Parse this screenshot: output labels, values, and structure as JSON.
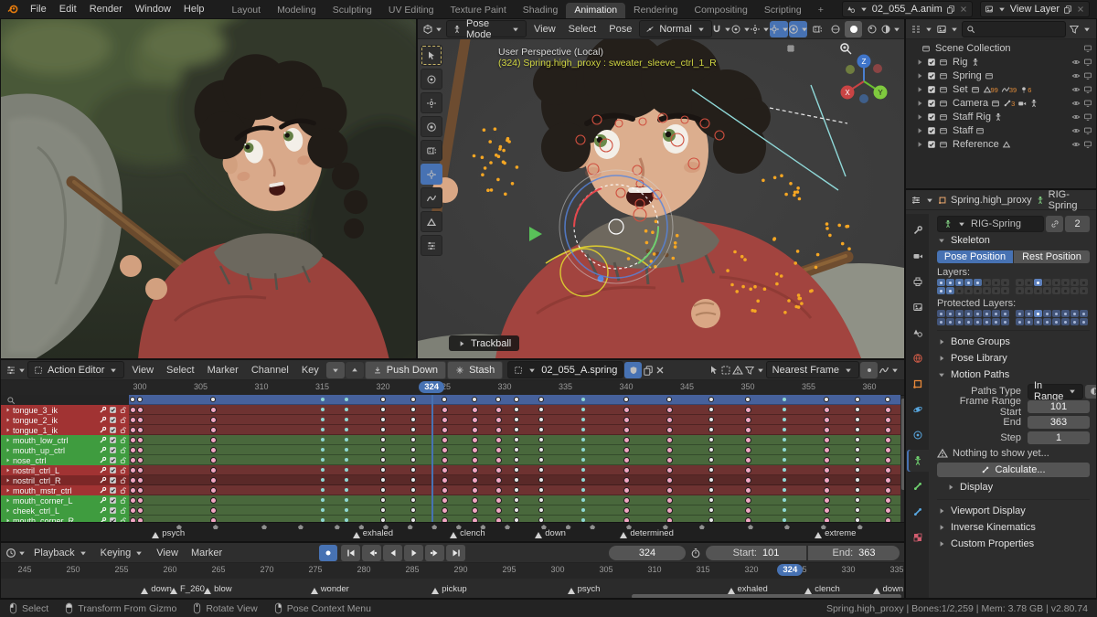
{
  "topbar": {
    "menus": [
      "File",
      "Edit",
      "Render",
      "Window",
      "Help"
    ],
    "workspaces": [
      "Layout",
      "Modeling",
      "Sculpting",
      "UV Editing",
      "Texture Paint",
      "Shading",
      "Animation",
      "Rendering",
      "Compositing",
      "Scripting"
    ],
    "active_workspace": "Animation",
    "new_workspace": "+",
    "scene_name": "02_055_A.anim",
    "view_layer_name": "View Layer"
  },
  "viewport": {
    "mode": "Pose Mode",
    "menus": [
      "View",
      "Select",
      "Pose"
    ],
    "orientation": "Normal",
    "overlay_line1": "User Perspective (Local)",
    "overlay_line2": "(324) Spring.high_proxy : sweater_sleeve_ctrl_1_R",
    "hint": "Trackball",
    "axes": {
      "x": "X",
      "y": "Y",
      "z": "Z"
    }
  },
  "outliner": {
    "root": "Scene Collection",
    "items": [
      {
        "label": "Rig",
        "badges": [
          {
            "icon": "armature"
          }
        ]
      },
      {
        "label": "Spring",
        "badges": [
          {
            "icon": "collection"
          }
        ]
      },
      {
        "label": "Set",
        "badges": [
          {
            "icon": "collection-link"
          },
          {
            "icon": "mesh",
            "count": "99"
          },
          {
            "icon": "curve",
            "count": "39"
          },
          {
            "icon": "light",
            "count": "6"
          }
        ]
      },
      {
        "label": "Camera",
        "badges": [
          {
            "icon": "collection-link"
          },
          {
            "icon": "bone",
            "count": "3"
          },
          {
            "icon": "camera"
          },
          {
            "icon": "armature"
          }
        ]
      },
      {
        "label": "Staff Rig",
        "badges": [
          {
            "icon": "armature"
          }
        ]
      },
      {
        "label": "Staff",
        "badges": [
          {
            "icon": "collection"
          }
        ]
      },
      {
        "label": "Reference",
        "badges": [
          {
            "icon": "mesh"
          }
        ]
      }
    ]
  },
  "properties": {
    "breadcrumb_object": "Spring.high_proxy",
    "breadcrumb_data": "RIG-Spring",
    "id_name": "RIG-Spring",
    "id_users": "2",
    "skeleton": {
      "title": "Skeleton",
      "pose_position": "Pose Position",
      "rest_position": "Rest Position",
      "layers_label": "Layers:",
      "layers": {
        "left": [
          [
            1,
            1,
            1,
            1,
            1,
            0,
            0,
            0
          ],
          [
            1,
            1,
            0,
            0,
            0,
            0,
            0,
            0
          ]
        ],
        "right": [
          [
            0,
            0,
            2,
            0,
            0,
            0,
            0,
            0
          ],
          [
            0,
            0,
            0,
            0,
            0,
            0,
            0,
            0
          ]
        ]
      },
      "protected_label": "Protected Layers:",
      "protected_layers": {
        "left": [
          [
            1,
            1,
            1,
            1,
            1,
            1,
            1,
            1
          ],
          [
            1,
            1,
            1,
            1,
            1,
            1,
            1,
            1
          ]
        ],
        "right": [
          [
            1,
            1,
            2,
            1,
            1,
            1,
            1,
            1
          ],
          [
            1,
            1,
            1,
            1,
            1,
            1,
            1,
            1
          ]
        ]
      }
    },
    "panels_above": [
      "Bone Groups",
      "Pose Library"
    ],
    "motion_paths": {
      "title": "Motion Paths",
      "paths_type_label": "Paths Type",
      "paths_type": "In Range",
      "fields": [
        {
          "label": "Frame Range Start",
          "value": "101"
        },
        {
          "label": "End",
          "value": "363"
        },
        {
          "label": "Step",
          "value": "1"
        }
      ],
      "warning": "Nothing to show yet...",
      "calculate": "Calculate...",
      "sub_panel": "Display"
    },
    "panels_below": [
      "Viewport Display",
      "Inverse Kinematics",
      "Custom Properties"
    ]
  },
  "dopesheet": {
    "editor": "Action Editor",
    "menus": [
      "View",
      "Select",
      "Marker",
      "Channel",
      "Key"
    ],
    "push_down": "Push Down",
    "stash": "Stash",
    "action_name": "02_055_A.spring",
    "snap": "Nearest Frame",
    "ruler": {
      "start": 300,
      "end": 360,
      "step": 5
    },
    "current_frame": "324",
    "channels": [
      {
        "name": "tongue_3_ik",
        "color": "red"
      },
      {
        "name": "tongue_2_ik",
        "color": "red"
      },
      {
        "name": "tongue_1_ik",
        "color": "red"
      },
      {
        "name": "mouth_low_ctrl",
        "color": "green"
      },
      {
        "name": "mouth_up_ctrl",
        "color": "green"
      },
      {
        "name": "nose_ctrl",
        "color": "green"
      },
      {
        "name": "nostril_ctrl_L",
        "color": "red"
      },
      {
        "name": "nostril_ctrl_R",
        "color": "darkred"
      },
      {
        "name": "mouth_mstr_ctrl",
        "color": "red"
      },
      {
        "name": "mouth_corner_L",
        "color": "green"
      },
      {
        "name": "cheek_ctrl_L",
        "color": "green"
      },
      {
        "name": "mouth_corner_R",
        "color": "green"
      }
    ],
    "keyframes": [
      {
        "f": 299.4,
        "t": "pink"
      },
      {
        "f": 300,
        "t": "pink"
      },
      {
        "f": 306,
        "t": "pink"
      },
      {
        "f": 315,
        "t": "cyan"
      },
      {
        "f": 317,
        "t": "cyan"
      },
      {
        "f": 320,
        "t": "white"
      },
      {
        "f": 322.5,
        "t": "white"
      },
      {
        "f": 325,
        "t": "pink"
      },
      {
        "f": 327.5,
        "t": "pink"
      },
      {
        "f": 329.5,
        "t": "pink"
      },
      {
        "f": 331,
        "t": "white"
      },
      {
        "f": 333,
        "t": "white"
      },
      {
        "f": 336.5,
        "t": "cyan"
      },
      {
        "f": 340,
        "t": "pink"
      },
      {
        "f": 343.5,
        "t": "pink"
      },
      {
        "f": 347,
        "t": "white"
      },
      {
        "f": 350,
        "t": "pink"
      },
      {
        "f": 353,
        "t": "cyan"
      },
      {
        "f": 356.5,
        "t": "pink"
      },
      {
        "f": 359,
        "t": "white"
      },
      {
        "f": 361.5,
        "t": "pink"
      }
    ],
    "markers": [
      {
        "label": "psych",
        "frame": 301
      },
      {
        "label": "exhaled",
        "frame": 317.5
      },
      {
        "label": "clench",
        "frame": 325.5
      },
      {
        "label": "down",
        "frame": 332.5
      },
      {
        "label": "determined",
        "frame": 339.5
      },
      {
        "label": "extreme",
        "frame": 355.5
      }
    ]
  },
  "timeline": {
    "menus": [
      "Playback",
      "Keying",
      "View",
      "Marker"
    ],
    "frame": "324",
    "start_label": "Start:",
    "start": "101",
    "end_label": "End:",
    "end": "363",
    "ruler": {
      "start": 245,
      "end": 335,
      "step": 5
    },
    "current_frame": 324,
    "markers": [
      {
        "label": "down",
        "frame": 257
      },
      {
        "label": "F_260",
        "frame": 260
      },
      {
        "label": "blow",
        "frame": 263.5
      },
      {
        "label": "wonder",
        "frame": 274.5
      },
      {
        "label": "pickup",
        "frame": 287
      },
      {
        "label": "psych",
        "frame": 301
      },
      {
        "label": "exhaled",
        "frame": 317.5
      },
      {
        "label": "clench",
        "frame": 325.5
      },
      {
        "label": "down",
        "frame": 332.5
      }
    ]
  },
  "statusbar": {
    "hints": [
      {
        "button": "left",
        "label": "Select"
      },
      {
        "button": "both",
        "label": "Transform From Gizmo"
      },
      {
        "button": "middle",
        "label": "Rotate View"
      },
      {
        "button": "right",
        "label": "Pose Context Menu"
      }
    ],
    "info": "Spring.high_proxy | Bones:1/2,259  | Mem: 3.78 GB | v2.80.74"
  },
  "colors": {
    "accent": "#4772b3",
    "keyframe_selected": "#f2a7c3",
    "keyframe": "#e9e9e9",
    "channel_red": "#a13333",
    "channel_dark_red": "#7c2727",
    "channel_green": "#3f9c3f"
  }
}
